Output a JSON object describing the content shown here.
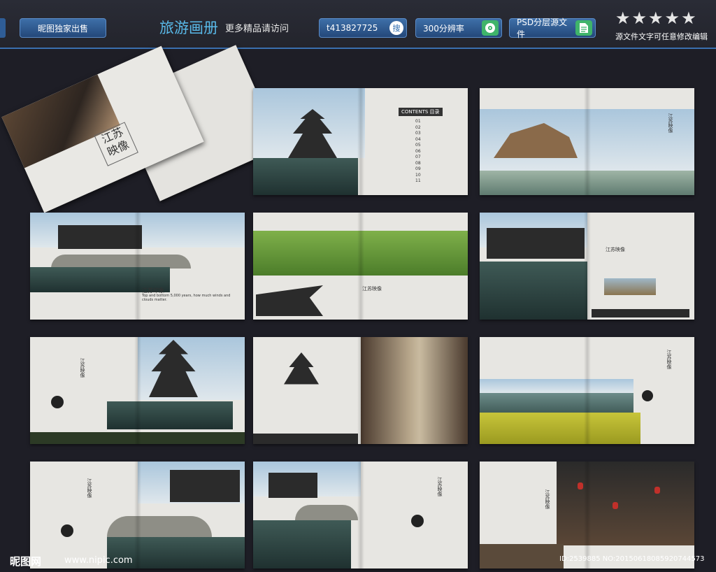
{
  "header": {
    "exclusive_label": "昵图独家出售",
    "title": "旅游画册",
    "subtitle": "更多精品请访问",
    "user_id": "t413827725",
    "search_badge": "搜",
    "resolution": "300分辨率",
    "psd_label": "PSD分层源文件",
    "stars_caption": "源文件文字可任意修改编辑",
    "star_count": 5
  },
  "cover": {
    "title_line1": "江苏",
    "title_line2": "映像"
  },
  "spreads": {
    "contents_label": "CONTENTS",
    "contents_cn": "目录",
    "contents_numbers": [
      "01",
      "02",
      "03",
      "04",
      "05",
      "06",
      "07",
      "08",
      "09",
      "10",
      "11"
    ],
    "caption_jiangsu_yin": "江苏印象",
    "caption_jiangsu_ying": "江苏映像",
    "caption_small_en": "Top and bottom 5,000 years, how much winds and clouds matter."
  },
  "footer": {
    "site_logo": "昵图网",
    "site_url": "www.nipic.com",
    "id_text": "ID:2539885 NO:20150618085920744573"
  },
  "colors": {
    "accent": "#59b9e8",
    "background": "#1e1e26",
    "button_blue": "#3e6fa8",
    "badge_green": "#3fb46a"
  }
}
